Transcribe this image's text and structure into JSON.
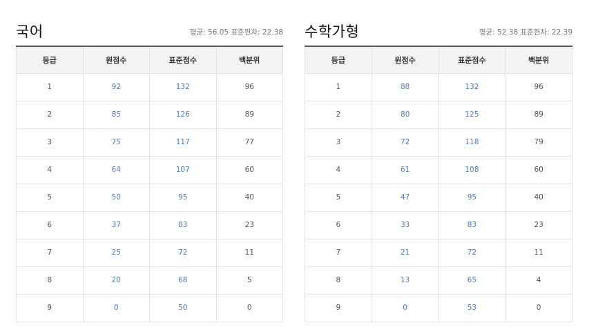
{
  "panels": [
    {
      "title": "국어",
      "stats": "평균: 56.05 표준편차: 22.38",
      "headers": [
        "등급",
        "원점수",
        "표준점수",
        "백분위"
      ],
      "rows": [
        {
          "grade": "1",
          "raw": "92",
          "std": "132",
          "pct": "96"
        },
        {
          "grade": "2",
          "raw": "85",
          "std": "126",
          "pct": "89"
        },
        {
          "grade": "3",
          "raw": "75",
          "std": "117",
          "pct": "77"
        },
        {
          "grade": "4",
          "raw": "64",
          "std": "107",
          "pct": "60"
        },
        {
          "grade": "5",
          "raw": "50",
          "std": "95",
          "pct": "40"
        },
        {
          "grade": "6",
          "raw": "37",
          "std": "83",
          "pct": "23"
        },
        {
          "grade": "7",
          "raw": "25",
          "std": "72",
          "pct": "11"
        },
        {
          "grade": "8",
          "raw": "20",
          "std": "68",
          "pct": "5"
        },
        {
          "grade": "9",
          "raw": "0",
          "std": "50",
          "pct": "0"
        }
      ]
    },
    {
      "title": "수학가형",
      "stats": "평균: 52.38 표준편차: 22.39",
      "headers": [
        "등급",
        "원점수",
        "표준점수",
        "백분위"
      ],
      "rows": [
        {
          "grade": "1",
          "raw": "88",
          "std": "132",
          "pct": "96"
        },
        {
          "grade": "2",
          "raw": "80",
          "std": "125",
          "pct": "89"
        },
        {
          "grade": "3",
          "raw": "72",
          "std": "118",
          "pct": "79"
        },
        {
          "grade": "4",
          "raw": "61",
          "std": "108",
          "pct": "60"
        },
        {
          "grade": "5",
          "raw": "47",
          "std": "95",
          "pct": "40"
        },
        {
          "grade": "6",
          "raw": "33",
          "std": "83",
          "pct": "23"
        },
        {
          "grade": "7",
          "raw": "21",
          "std": "72",
          "pct": "11"
        },
        {
          "grade": "8",
          "raw": "13",
          "std": "65",
          "pct": "4"
        },
        {
          "grade": "9",
          "raw": "0",
          "std": "53",
          "pct": "0"
        }
      ]
    }
  ]
}
